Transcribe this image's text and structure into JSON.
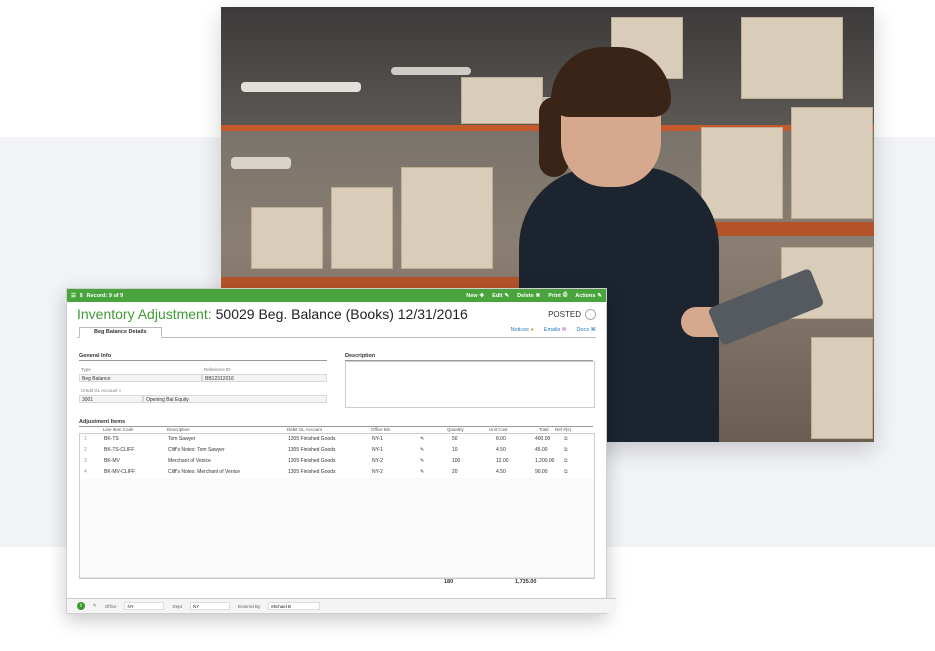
{
  "toolbar": {
    "record": "Record: 9 of 9",
    "new": "New",
    "edit": "Edit",
    "delete": "Delete",
    "print": "Print",
    "actions": "Actions"
  },
  "header": {
    "label": "Inventory Adjustment:",
    "value": "50029 Beg. Balance (Books) 12/31/2016",
    "status": "POSTED"
  },
  "tabs": [
    "Beg Balance Details"
  ],
  "links": {
    "notices": "Notices",
    "emails": "Emails",
    "docs": "Docs"
  },
  "general_info": {
    "heading": "General Info",
    "type_label": "Type",
    "type_value": "Beg Balance",
    "ref_label": "Reference ID",
    "ref_value": "BB12312016",
    "credit_label": "Credit GL Account »",
    "credit_account": "3001",
    "credit_name": "Opening Bal Equity"
  },
  "description": {
    "heading": "Description"
  },
  "adjustment_items": {
    "heading": "Adjustment Items",
    "columns": [
      "Line Item Code",
      "Description",
      "Debit GL Account",
      "Office Bin",
      "Quantity",
      "Unit Cost",
      "Total",
      "Ref #(s)"
    ],
    "rows": [
      {
        "n": "1",
        "code": "BK-TS",
        "desc": "Tom Sawyer",
        "gl": "1305 Finished Goods",
        "bin": "NY-1",
        "qty": "50",
        "cost": "8.00",
        "total": "400.00"
      },
      {
        "n": "2",
        "code": "BK-TS-CLIFF",
        "desc": "Cliff's Notes: Tom Sawyer",
        "gl": "1305 Finished Goods",
        "bin": "NY-1",
        "qty": "10",
        "cost": "4.50",
        "total": "45.00"
      },
      {
        "n": "3",
        "code": "BK-MV",
        "desc": "Merchant of Venice",
        "gl": "1305 Finished Goods",
        "bin": "NY-2",
        "qty": "100",
        "cost": "12.00",
        "total": "1,200.00"
      },
      {
        "n": "4",
        "code": "BK-MV-CLIFF",
        "desc": "Cliff's Notes: Merchant of Venice",
        "gl": "1305 Finished Goods",
        "bin": "NY-2",
        "qty": "20",
        "cost": "4.50",
        "total": "90.00"
      }
    ],
    "total_qty": "180",
    "total_amount": "1,735.00"
  },
  "footer": {
    "office_label": "Office",
    "office_value": "NY",
    "dept_label": "Dept",
    "dept_value": "NY",
    "entered_label": "Entered By",
    "entered_value": "Michael B"
  },
  "colors": {
    "brand_green": "#4aa43d",
    "title_green": "#3f9a33",
    "band": "#f1f3f7"
  }
}
